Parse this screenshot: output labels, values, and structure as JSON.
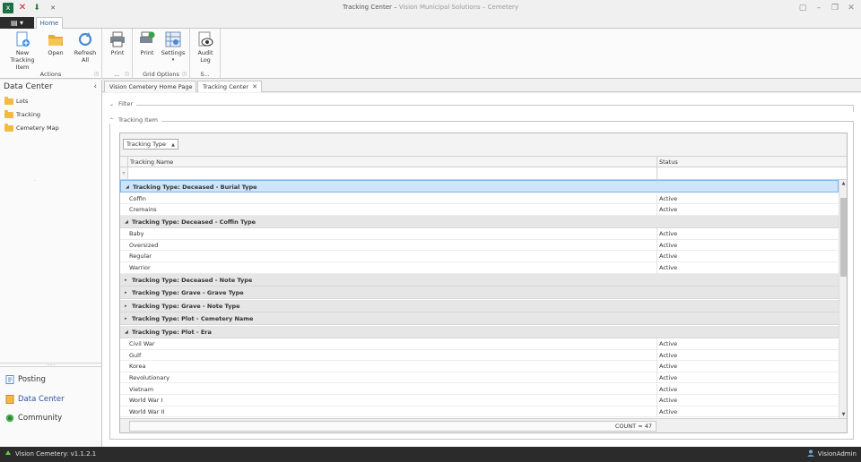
{
  "window": {
    "title": "Tracking Center",
    "subtitle": "Vision Municipal Solutions – Cemetery"
  },
  "ribbon": {
    "app_menu": "▤ ▾",
    "home_tab": "Home",
    "groups": [
      {
        "label": "Actions",
        "buttons": [
          {
            "label": "New Tracking\nItem"
          },
          {
            "label": "Open"
          },
          {
            "label": "Refresh\nAll"
          }
        ]
      },
      {
        "label": "...",
        "buttons": [
          {
            "label": "Print"
          }
        ]
      },
      {
        "label": "Grid Options",
        "buttons": [
          {
            "label": "Print"
          },
          {
            "label": "Settings"
          }
        ]
      },
      {
        "label": "S...",
        "buttons": [
          {
            "label": "Audit\nLog"
          }
        ]
      }
    ]
  },
  "left_panel": {
    "title": "Data Center",
    "items": [
      {
        "label": "Lots"
      },
      {
        "label": "Tracking"
      },
      {
        "label": "Cemetery Map"
      }
    ],
    "dot": "·",
    "grip": "......",
    "nav": [
      {
        "label": "Posting",
        "icon": "posting-icon"
      },
      {
        "label": "Data Center",
        "icon": "data-center-icon"
      },
      {
        "label": "Community",
        "icon": "community-icon"
      }
    ]
  },
  "doc_tabs": [
    {
      "label": "Vision Cemetery Home Page"
    },
    {
      "label": "Tracking Center"
    }
  ],
  "filter_group": {
    "label": "Filter"
  },
  "tracking_group": {
    "label": "Tracking Item"
  },
  "grid": {
    "group_chip": "Tracking Type",
    "columns": [
      "Tracking Name",
      "Status"
    ],
    "rows": [
      {
        "type": "group",
        "label": "Tracking Type: Deceased - Burial Type",
        "expanded": true,
        "focused": true
      },
      {
        "type": "data",
        "name": "Coffin",
        "status": "Active"
      },
      {
        "type": "data",
        "name": "Cremains",
        "status": "Active"
      },
      {
        "type": "group",
        "label": "Tracking Type: Deceased - Coffin Type",
        "expanded": true
      },
      {
        "type": "data",
        "name": "Baby",
        "status": "Active"
      },
      {
        "type": "data",
        "name": "Oversized",
        "status": "Active"
      },
      {
        "type": "data",
        "name": "Regular",
        "status": "Active"
      },
      {
        "type": "data",
        "name": "Warrior",
        "status": "Active"
      },
      {
        "type": "group",
        "label": "Tracking Type: Deceased - Note Type",
        "expanded": false
      },
      {
        "type": "group",
        "label": "Tracking Type: Grave - Grave Type",
        "expanded": false
      },
      {
        "type": "group",
        "label": "Tracking Type: Grave - Note Type",
        "expanded": false
      },
      {
        "type": "group",
        "label": "Tracking Type: Plot - Cemetery Name",
        "expanded": false
      },
      {
        "type": "group",
        "label": "Tracking Type: Plot - Era",
        "expanded": true
      },
      {
        "type": "data",
        "name": "Civil War",
        "status": "Active"
      },
      {
        "type": "data",
        "name": "Gulf",
        "status": "Active"
      },
      {
        "type": "data",
        "name": "Korea",
        "status": "Active"
      },
      {
        "type": "data",
        "name": "Revolutionary",
        "status": "Active"
      },
      {
        "type": "data",
        "name": "Vietnam",
        "status": "Active"
      },
      {
        "type": "data",
        "name": "World War I",
        "status": "Active"
      },
      {
        "type": "data",
        "name": "World War II",
        "status": "Active"
      }
    ],
    "count": "COUNT = 47"
  },
  "statusbar": {
    "version": "Vision Cemetery: v1.1.2.1",
    "user": "VisionAdmin"
  },
  "colors": {
    "accent": "#2b579a",
    "focus_row": "#cde4fa",
    "statusbar": "#2b2b2b"
  }
}
